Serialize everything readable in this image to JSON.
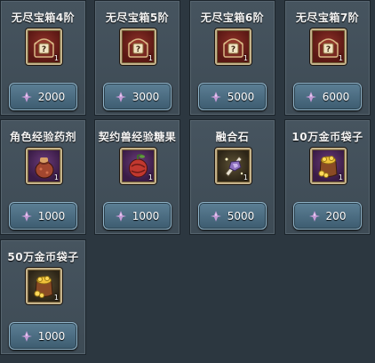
{
  "shop": {
    "items": [
      {
        "name": "无尽宝箱4阶",
        "icon": "treasure-chest-icon",
        "quantity": "1",
        "price": "2000"
      },
      {
        "name": "无尽宝箱5阶",
        "icon": "treasure-chest-icon",
        "quantity": "1",
        "price": "3000"
      },
      {
        "name": "无尽宝箱6阶",
        "icon": "treasure-chest-icon",
        "quantity": "1",
        "price": "5000"
      },
      {
        "name": "无尽宝箱7阶",
        "icon": "treasure-chest-icon",
        "quantity": "1",
        "price": "6000"
      },
      {
        "name": "角色经验药剂",
        "icon": "potion-pouch-icon",
        "quantity": "1",
        "price": "1000"
      },
      {
        "name": "契约兽经验糖果",
        "icon": "candy-fruit-icon",
        "quantity": "1",
        "price": "1000"
      },
      {
        "name": "融合石",
        "icon": "fusion-stone-icon",
        "quantity": "1",
        "price": "5000"
      },
      {
        "name": "10万金币袋子",
        "icon": "gold-coin-bag-icon",
        "quantity": "1",
        "price": "200"
      },
      {
        "name": "50万金币袋子",
        "icon": "gold-coin-bag-icon",
        "quantity": "1",
        "price": "1000"
      }
    ],
    "currency_icon": "purple-crystal-icon",
    "colors": {
      "background": "#2c3740",
      "card": "#46545f",
      "price_button": "#4e6f84",
      "gold_frame": "#c4b28a",
      "currency": "#c59ad6"
    }
  }
}
